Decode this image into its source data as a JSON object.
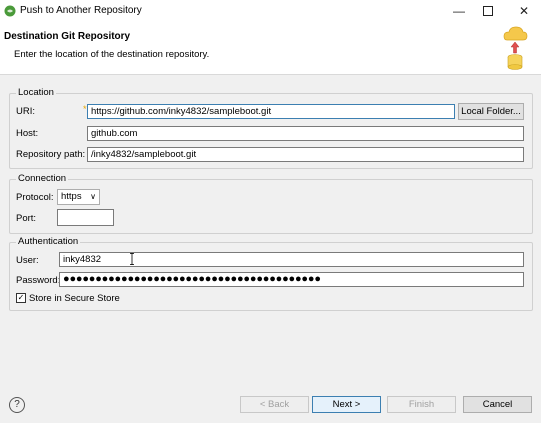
{
  "window": {
    "title": "Push to Another Repository",
    "minimize_glyph": "—",
    "close_glyph": "✕"
  },
  "header": {
    "title": "Destination Git Repository",
    "description": "Enter the location of the destination repository."
  },
  "location": {
    "group_title": "Location",
    "uri_label": "URI:",
    "uri_value": "https://github.com/inky4832/sampleboot.git",
    "local_folder_button": "Local Folder...",
    "host_label": "Host:",
    "host_value": "github.com",
    "repo_path_label": "Repository path:",
    "repo_path_value": "/inky4832/sampleboot.git"
  },
  "connection": {
    "group_title": "Connection",
    "protocol_label": "Protocol:",
    "protocol_value": "https",
    "port_label": "Port:",
    "port_value": ""
  },
  "authentication": {
    "group_title": "Authentication",
    "user_label": "User:",
    "user_value": "inky4832",
    "password_label": "Password:",
    "password_mask": "●●●●●●●●●●●●●●●●●●●●●●●●●●●●●●●●●●●●●●●●",
    "store_label": "Store in Secure Store",
    "store_checked": true
  },
  "footer": {
    "help_glyph": "?",
    "back_button": "< Back",
    "next_button": "Next >",
    "finish_button": "Finish",
    "cancel_button": "Cancel"
  }
}
